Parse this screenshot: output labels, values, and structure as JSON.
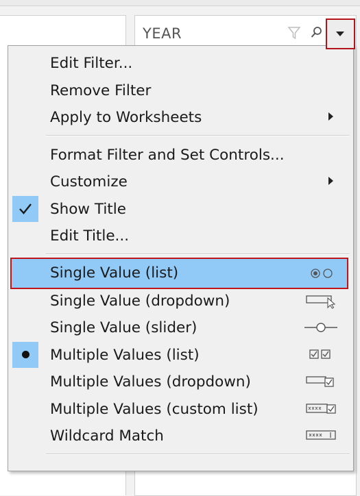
{
  "filter_card": {
    "title": "YEAR"
  },
  "menu": {
    "group_1": [
      {
        "label": "Edit Filter..."
      },
      {
        "label": "Remove Filter"
      },
      {
        "label": "Apply to Worksheets"
      }
    ],
    "group_2": [
      {
        "label": "Format Filter and Set Controls..."
      },
      {
        "label": "Customize"
      },
      {
        "label": "Show Title"
      },
      {
        "label": "Edit Title..."
      }
    ],
    "group_3": [
      {
        "label": "Single Value (list)"
      },
      {
        "label": "Single Value (dropdown)"
      },
      {
        "label": "Single Value (slider)"
      },
      {
        "label": "Multiple Values (list)"
      },
      {
        "label": "Multiple Values (dropdown)"
      },
      {
        "label": "Multiple Values (custom list)"
      },
      {
        "label": "Wildcard Match"
      }
    ]
  },
  "colors": {
    "highlight": "#91c9f7",
    "callout_border": "#c0141b",
    "menu_background": "#f0f0f0"
  },
  "icons": {
    "dropdown": "chevron-down-icon",
    "filter": "filter-icon",
    "search": "search-icon",
    "submenu": "chevron-right-icon",
    "show_title_state": "checkmark-icon",
    "multiple_values_state": "bullet-icon"
  }
}
